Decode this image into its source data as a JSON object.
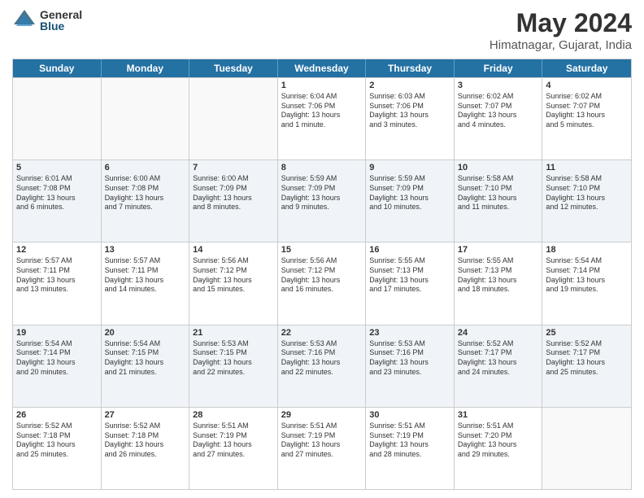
{
  "logo": {
    "general": "General",
    "blue": "Blue"
  },
  "title": {
    "month": "May 2024",
    "location": "Himatnagar, Gujarat, India"
  },
  "header_days": [
    "Sunday",
    "Monday",
    "Tuesday",
    "Wednesday",
    "Thursday",
    "Friday",
    "Saturday"
  ],
  "rows": [
    {
      "alt": false,
      "cells": [
        {
          "day": "",
          "lines": []
        },
        {
          "day": "",
          "lines": []
        },
        {
          "day": "",
          "lines": []
        },
        {
          "day": "1",
          "lines": [
            "Sunrise: 6:04 AM",
            "Sunset: 7:06 PM",
            "Daylight: 13 hours",
            "and 1 minute."
          ]
        },
        {
          "day": "2",
          "lines": [
            "Sunrise: 6:03 AM",
            "Sunset: 7:06 PM",
            "Daylight: 13 hours",
            "and 3 minutes."
          ]
        },
        {
          "day": "3",
          "lines": [
            "Sunrise: 6:02 AM",
            "Sunset: 7:07 PM",
            "Daylight: 13 hours",
            "and 4 minutes."
          ]
        },
        {
          "day": "4",
          "lines": [
            "Sunrise: 6:02 AM",
            "Sunset: 7:07 PM",
            "Daylight: 13 hours",
            "and 5 minutes."
          ]
        }
      ]
    },
    {
      "alt": true,
      "cells": [
        {
          "day": "5",
          "lines": [
            "Sunrise: 6:01 AM",
            "Sunset: 7:08 PM",
            "Daylight: 13 hours",
            "and 6 minutes."
          ]
        },
        {
          "day": "6",
          "lines": [
            "Sunrise: 6:00 AM",
            "Sunset: 7:08 PM",
            "Daylight: 13 hours",
            "and 7 minutes."
          ]
        },
        {
          "day": "7",
          "lines": [
            "Sunrise: 6:00 AM",
            "Sunset: 7:09 PM",
            "Daylight: 13 hours",
            "and 8 minutes."
          ]
        },
        {
          "day": "8",
          "lines": [
            "Sunrise: 5:59 AM",
            "Sunset: 7:09 PM",
            "Daylight: 13 hours",
            "and 9 minutes."
          ]
        },
        {
          "day": "9",
          "lines": [
            "Sunrise: 5:59 AM",
            "Sunset: 7:09 PM",
            "Daylight: 13 hours",
            "and 10 minutes."
          ]
        },
        {
          "day": "10",
          "lines": [
            "Sunrise: 5:58 AM",
            "Sunset: 7:10 PM",
            "Daylight: 13 hours",
            "and 11 minutes."
          ]
        },
        {
          "day": "11",
          "lines": [
            "Sunrise: 5:58 AM",
            "Sunset: 7:10 PM",
            "Daylight: 13 hours",
            "and 12 minutes."
          ]
        }
      ]
    },
    {
      "alt": false,
      "cells": [
        {
          "day": "12",
          "lines": [
            "Sunrise: 5:57 AM",
            "Sunset: 7:11 PM",
            "Daylight: 13 hours",
            "and 13 minutes."
          ]
        },
        {
          "day": "13",
          "lines": [
            "Sunrise: 5:57 AM",
            "Sunset: 7:11 PM",
            "Daylight: 13 hours",
            "and 14 minutes."
          ]
        },
        {
          "day": "14",
          "lines": [
            "Sunrise: 5:56 AM",
            "Sunset: 7:12 PM",
            "Daylight: 13 hours",
            "and 15 minutes."
          ]
        },
        {
          "day": "15",
          "lines": [
            "Sunrise: 5:56 AM",
            "Sunset: 7:12 PM",
            "Daylight: 13 hours",
            "and 16 minutes."
          ]
        },
        {
          "day": "16",
          "lines": [
            "Sunrise: 5:55 AM",
            "Sunset: 7:13 PM",
            "Daylight: 13 hours",
            "and 17 minutes."
          ]
        },
        {
          "day": "17",
          "lines": [
            "Sunrise: 5:55 AM",
            "Sunset: 7:13 PM",
            "Daylight: 13 hours",
            "and 18 minutes."
          ]
        },
        {
          "day": "18",
          "lines": [
            "Sunrise: 5:54 AM",
            "Sunset: 7:14 PM",
            "Daylight: 13 hours",
            "and 19 minutes."
          ]
        }
      ]
    },
    {
      "alt": true,
      "cells": [
        {
          "day": "19",
          "lines": [
            "Sunrise: 5:54 AM",
            "Sunset: 7:14 PM",
            "Daylight: 13 hours",
            "and 20 minutes."
          ]
        },
        {
          "day": "20",
          "lines": [
            "Sunrise: 5:54 AM",
            "Sunset: 7:15 PM",
            "Daylight: 13 hours",
            "and 21 minutes."
          ]
        },
        {
          "day": "21",
          "lines": [
            "Sunrise: 5:53 AM",
            "Sunset: 7:15 PM",
            "Daylight: 13 hours",
            "and 22 minutes."
          ]
        },
        {
          "day": "22",
          "lines": [
            "Sunrise: 5:53 AM",
            "Sunset: 7:16 PM",
            "Daylight: 13 hours",
            "and 22 minutes."
          ]
        },
        {
          "day": "23",
          "lines": [
            "Sunrise: 5:53 AM",
            "Sunset: 7:16 PM",
            "Daylight: 13 hours",
            "and 23 minutes."
          ]
        },
        {
          "day": "24",
          "lines": [
            "Sunrise: 5:52 AM",
            "Sunset: 7:17 PM",
            "Daylight: 13 hours",
            "and 24 minutes."
          ]
        },
        {
          "day": "25",
          "lines": [
            "Sunrise: 5:52 AM",
            "Sunset: 7:17 PM",
            "Daylight: 13 hours",
            "and 25 minutes."
          ]
        }
      ]
    },
    {
      "alt": false,
      "cells": [
        {
          "day": "26",
          "lines": [
            "Sunrise: 5:52 AM",
            "Sunset: 7:18 PM",
            "Daylight: 13 hours",
            "and 25 minutes."
          ]
        },
        {
          "day": "27",
          "lines": [
            "Sunrise: 5:52 AM",
            "Sunset: 7:18 PM",
            "Daylight: 13 hours",
            "and 26 minutes."
          ]
        },
        {
          "day": "28",
          "lines": [
            "Sunrise: 5:51 AM",
            "Sunset: 7:19 PM",
            "Daylight: 13 hours",
            "and 27 minutes."
          ]
        },
        {
          "day": "29",
          "lines": [
            "Sunrise: 5:51 AM",
            "Sunset: 7:19 PM",
            "Daylight: 13 hours",
            "and 27 minutes."
          ]
        },
        {
          "day": "30",
          "lines": [
            "Sunrise: 5:51 AM",
            "Sunset: 7:19 PM",
            "Daylight: 13 hours",
            "and 28 minutes."
          ]
        },
        {
          "day": "31",
          "lines": [
            "Sunrise: 5:51 AM",
            "Sunset: 7:20 PM",
            "Daylight: 13 hours",
            "and 29 minutes."
          ]
        },
        {
          "day": "",
          "lines": []
        }
      ]
    }
  ]
}
